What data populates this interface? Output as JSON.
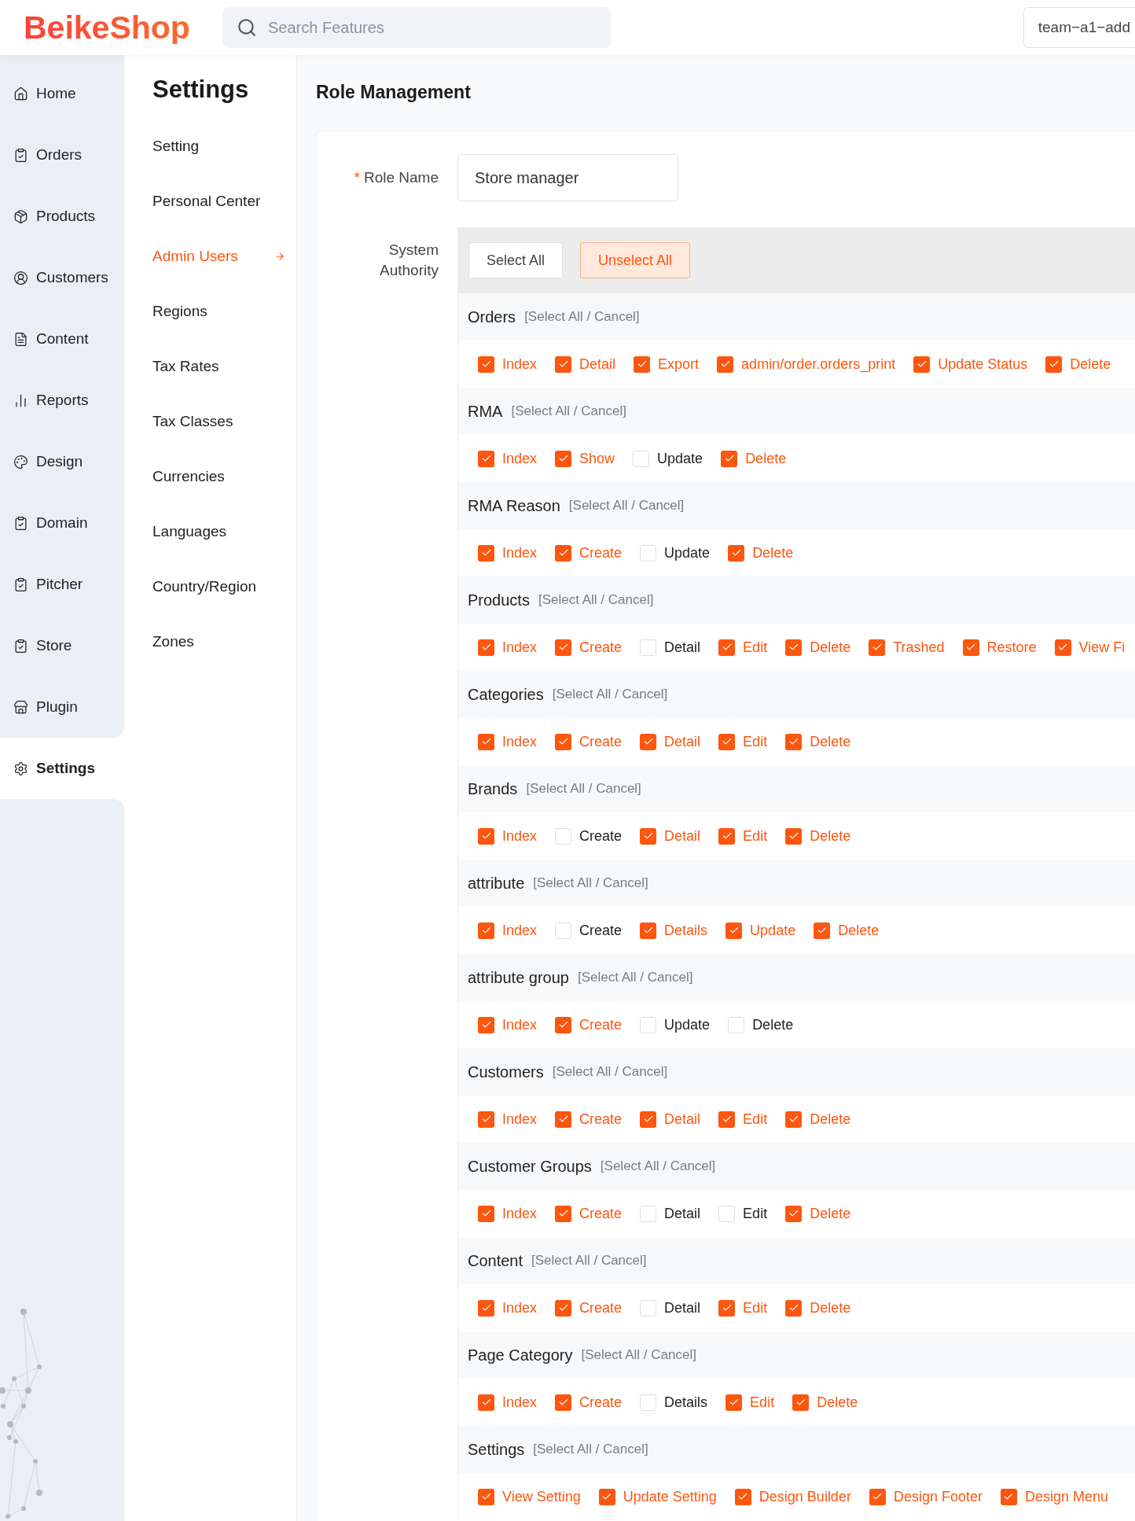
{
  "header": {
    "logo": "BeikeShop",
    "search": {
      "placeholder": "Search Features"
    },
    "store_select": "team−a1−add"
  },
  "nav": [
    {
      "label": "Home",
      "selected": false
    },
    {
      "label": "Orders",
      "selected": false
    },
    {
      "label": "Products",
      "selected": false
    },
    {
      "label": "Customers",
      "selected": false
    },
    {
      "label": "Content",
      "selected": false
    },
    {
      "label": "Reports",
      "selected": false
    },
    {
      "label": "Design",
      "selected": false
    },
    {
      "label": "Domain",
      "selected": false
    },
    {
      "label": "Pitcher",
      "selected": false
    },
    {
      "label": "Store",
      "selected": false
    },
    {
      "label": "Plugin",
      "selected": false
    },
    {
      "label": "Settings",
      "selected": true
    }
  ],
  "submenu": {
    "title": "Settings",
    "items": [
      {
        "label": "Setting",
        "selected": false
      },
      {
        "label": "Personal Center",
        "selected": false
      },
      {
        "label": "Admin Users",
        "selected": true
      },
      {
        "label": "Regions",
        "selected": false
      },
      {
        "label": "Tax Rates",
        "selected": false
      },
      {
        "label": "Tax Classes",
        "selected": false
      },
      {
        "label": "Currencies",
        "selected": false
      },
      {
        "label": "Languages",
        "selected": false
      },
      {
        "label": "Country/Region",
        "selected": false
      },
      {
        "label": "Zones",
        "selected": false
      }
    ]
  },
  "page_title": "Role Management",
  "form": {
    "role_name": {
      "required_mark": "*",
      "label": "Role Name",
      "value": "Store manager"
    },
    "authority": {
      "label": "System Authority",
      "buttons": [
        {
          "label": "Select All",
          "kind": "default"
        },
        {
          "label": "Unselect All",
          "kind": "primary"
        }
      ],
      "groups": [
        {
          "title": "Orders",
          "toggle": "[Select All / Cancel]",
          "permissions": [
            {
              "label": "Index",
              "checked": true
            },
            {
              "label": "Detail",
              "checked": true
            },
            {
              "label": "Export",
              "checked": true
            },
            {
              "label": "admin/order.orders_print",
              "checked": true
            },
            {
              "label": "Update Status",
              "checked": true
            },
            {
              "label": "Delete",
              "checked": true
            }
          ]
        },
        {
          "title": "RMA",
          "toggle": "[Select All / Cancel]",
          "permissions": [
            {
              "label": "Index",
              "checked": true
            },
            {
              "label": "Show",
              "checked": true
            },
            {
              "label": "Update",
              "checked": false
            },
            {
              "label": "Delete",
              "checked": true
            }
          ]
        },
        {
          "title": "RMA Reason",
          "toggle": "[Select All / Cancel]",
          "permissions": [
            {
              "label": "Index",
              "checked": true
            },
            {
              "label": "Create",
              "checked": true
            },
            {
              "label": "Update",
              "checked": false
            },
            {
              "label": "Delete",
              "checked": true
            }
          ]
        },
        {
          "title": "Products",
          "toggle": "[Select All / Cancel]",
          "permissions": [
            {
              "label": "Index",
              "checked": true
            },
            {
              "label": "Create",
              "checked": true
            },
            {
              "label": "Detail",
              "checked": false
            },
            {
              "label": "Edit",
              "checked": true
            },
            {
              "label": "Delete",
              "checked": true
            },
            {
              "label": "Trashed",
              "checked": true
            },
            {
              "label": "Restore",
              "checked": true
            },
            {
              "label": "View Fi",
              "checked": true
            }
          ]
        },
        {
          "title": "Categories",
          "toggle": "[Select All / Cancel]",
          "permissions": [
            {
              "label": "Index",
              "checked": true
            },
            {
              "label": "Create",
              "checked": true
            },
            {
              "label": "Detail",
              "checked": true
            },
            {
              "label": "Edit",
              "checked": true
            },
            {
              "label": "Delete",
              "checked": true
            }
          ]
        },
        {
          "title": "Brands",
          "toggle": "[Select All / Cancel]",
          "permissions": [
            {
              "label": "Index",
              "checked": true
            },
            {
              "label": "Create",
              "checked": false
            },
            {
              "label": "Detail",
              "checked": true
            },
            {
              "label": "Edit",
              "checked": true
            },
            {
              "label": "Delete",
              "checked": true
            }
          ]
        },
        {
          "title": "attribute",
          "toggle": "[Select All / Cancel]",
          "permissions": [
            {
              "label": "Index",
              "checked": true
            },
            {
              "label": "Create",
              "checked": false
            },
            {
              "label": "Details",
              "checked": true
            },
            {
              "label": "Update",
              "checked": true
            },
            {
              "label": "Delete",
              "checked": true
            }
          ]
        },
        {
          "title": "attribute group",
          "toggle": "[Select All / Cancel]",
          "permissions": [
            {
              "label": "Index",
              "checked": true
            },
            {
              "label": "Create",
              "checked": true
            },
            {
              "label": "Update",
              "checked": false
            },
            {
              "label": "Delete",
              "checked": false
            }
          ]
        },
        {
          "title": "Customers",
          "toggle": "[Select All / Cancel]",
          "permissions": [
            {
              "label": "Index",
              "checked": true
            },
            {
              "label": "Create",
              "checked": true
            },
            {
              "label": "Detail",
              "checked": true
            },
            {
              "label": "Edit",
              "checked": true
            },
            {
              "label": "Delete",
              "checked": true
            }
          ]
        },
        {
          "title": "Customer Groups",
          "toggle": "[Select All / Cancel]",
          "permissions": [
            {
              "label": "Index",
              "checked": true
            },
            {
              "label": "Create",
              "checked": true
            },
            {
              "label": "Detail",
              "checked": false
            },
            {
              "label": "Edit",
              "checked": false
            },
            {
              "label": "Delete",
              "checked": true
            }
          ]
        },
        {
          "title": "Content",
          "toggle": "[Select All / Cancel]",
          "permissions": [
            {
              "label": "Index",
              "checked": true
            },
            {
              "label": "Create",
              "checked": true
            },
            {
              "label": "Detail",
              "checked": false
            },
            {
              "label": "Edit",
              "checked": true
            },
            {
              "label": "Delete",
              "checked": true
            }
          ]
        },
        {
          "title": "Page Category",
          "toggle": "[Select All / Cancel]",
          "permissions": [
            {
              "label": "Index",
              "checked": true
            },
            {
              "label": "Create",
              "checked": true
            },
            {
              "label": "Details",
              "checked": false
            },
            {
              "label": "Edit",
              "checked": true
            },
            {
              "label": "Delete",
              "checked": true
            }
          ]
        },
        {
          "title": "Settings",
          "toggle": "[Select All / Cancel]",
          "permissions": [
            {
              "label": "View Setting",
              "checked": true
            },
            {
              "label": "Update Setting",
              "checked": true
            },
            {
              "label": "Design Builder",
              "checked": true
            },
            {
              "label": "Design Footer",
              "checked": true
            },
            {
              "label": "Design Menu",
              "checked": true
            }
          ]
        }
      ]
    }
  }
}
